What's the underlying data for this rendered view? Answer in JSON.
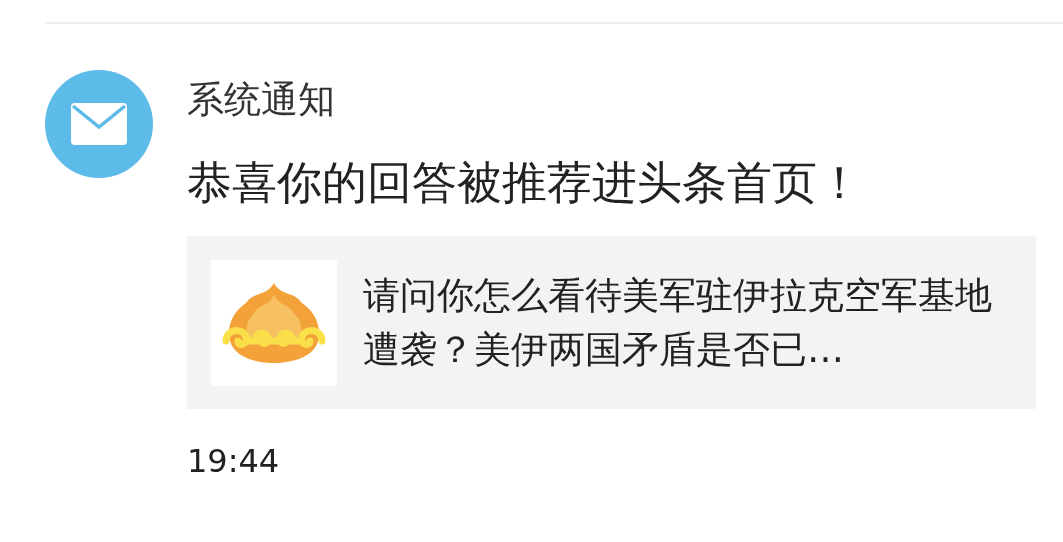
{
  "notification": {
    "sender": "系统通知",
    "message": "恭喜你的回答被推荐进头条首页！",
    "card": {
      "question": "请问你怎么看待美军驻伊拉克空军基地遭袭？美伊两国矛盾是否已…"
    },
    "time": "19:44"
  }
}
